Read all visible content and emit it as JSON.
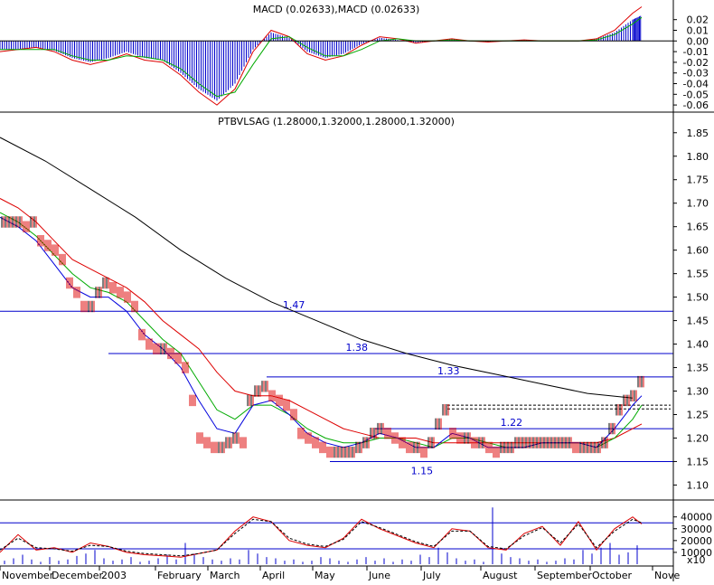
{
  "chart_data": [
    {
      "type": "line",
      "panel": "macd",
      "title": "MACD (0.02633),MACD (0.02633)",
      "ylim": [
        -0.065,
        0.035
      ],
      "yticks": [
        "0.02",
        "0.01",
        "0.00",
        "-0.01",
        "-0.02",
        "-0.03",
        "-0.04",
        "-0.05",
        "-0.06"
      ],
      "zero_line": 0,
      "series": [
        {
          "color": "#dd0000",
          "x": [
            0,
            20,
            40,
            60,
            80,
            100,
            120,
            140,
            160,
            180,
            200,
            220,
            240,
            260,
            280,
            300,
            320,
            340,
            360,
            380,
            400,
            420,
            440,
            460,
            480,
            500,
            520,
            540,
            560,
            580,
            600,
            620,
            640,
            660,
            680,
            700,
            710
          ],
          "values": [
            -0.01,
            -0.008,
            -0.006,
            -0.01,
            -0.018,
            -0.022,
            -0.018,
            -0.012,
            -0.018,
            -0.02,
            -0.032,
            -0.048,
            -0.06,
            -0.045,
            -0.01,
            0.01,
            0.004,
            -0.012,
            -0.018,
            -0.014,
            -0.004,
            0.004,
            0.002,
            -0.002,
            0.0,
            0.002,
            0.0,
            -0.001,
            0.0,
            0.001,
            0.0,
            0.0,
            0.0,
            0.002,
            0.01,
            0.026,
            0.032
          ]
        },
        {
          "color": "#00aa00",
          "x": [
            0,
            20,
            40,
            60,
            80,
            100,
            120,
            140,
            160,
            180,
            200,
            220,
            240,
            260,
            280,
            300,
            320,
            340,
            360,
            380,
            400,
            420,
            440,
            460,
            480,
            500,
            520,
            540,
            560,
            580,
            600,
            620,
            640,
            660,
            680,
            700,
            710
          ],
          "values": [
            -0.008,
            -0.008,
            -0.008,
            -0.008,
            -0.014,
            -0.018,
            -0.018,
            -0.014,
            -0.015,
            -0.018,
            -0.026,
            -0.04,
            -0.052,
            -0.048,
            -0.022,
            0.002,
            0.004,
            -0.006,
            -0.014,
            -0.014,
            -0.008,
            0.0,
            0.002,
            0.0,
            0.0,
            0.001,
            0.0,
            0.0,
            0.0,
            0.0,
            0.0,
            0.0,
            0.0,
            0.001,
            0.006,
            0.016,
            0.022
          ]
        }
      ],
      "histogram": {
        "color": "#0000cc",
        "x": [
          0,
          20,
          40,
          60,
          80,
          100,
          120,
          140,
          160,
          180,
          200,
          220,
          240,
          260,
          280,
          300,
          320,
          340,
          360,
          380,
          400,
          420,
          440,
          460,
          480,
          500,
          520,
          540,
          560,
          580,
          600,
          620,
          640,
          660,
          680,
          700,
          710
        ],
        "values": [
          -0.008,
          -0.008,
          -0.006,
          -0.009,
          -0.016,
          -0.02,
          -0.016,
          -0.01,
          -0.016,
          -0.018,
          -0.03,
          -0.045,
          -0.056,
          -0.04,
          -0.008,
          0.008,
          0.003,
          -0.01,
          -0.016,
          -0.012,
          -0.003,
          0.003,
          0.001,
          -0.002,
          0.0,
          0.002,
          0.0,
          -0.001,
          0.0,
          0.001,
          0.0,
          0.0,
          0.0,
          0.002,
          0.008,
          0.02,
          0.024
        ]
      }
    },
    {
      "type": "line",
      "panel": "price",
      "title": "PTBVLSAG (1.28000,1.32000,1.28000,1.32000)",
      "ylim": [
        1.07,
        1.89
      ],
      "yticks": [
        "1.85",
        "1.80",
        "1.75",
        "1.70",
        "1.65",
        "1.60",
        "1.55",
        "1.50",
        "1.45",
        "1.40",
        "1.35",
        "1.30",
        "1.25",
        "1.20",
        "1.15",
        "1.10"
      ],
      "series": [
        {
          "color": "#000000",
          "x": [
            0,
            50,
            100,
            150,
            200,
            250,
            300,
            350,
            400,
            450,
            500,
            550,
            600,
            650,
            700
          ],
          "values": [
            1.84,
            1.79,
            1.73,
            1.67,
            1.6,
            1.54,
            1.49,
            1.45,
            1.41,
            1.38,
            1.355,
            1.335,
            1.315,
            1.295,
            1.285
          ]
        },
        {
          "color": "#dd0000",
          "x": [
            0,
            20,
            40,
            60,
            80,
            100,
            120,
            140,
            160,
            180,
            200,
            220,
            240,
            260,
            280,
            300,
            320,
            340,
            360,
            380,
            400,
            420,
            440,
            460,
            480,
            500,
            520,
            540,
            560,
            580,
            600,
            620,
            640,
            660,
            680,
            700,
            710
          ],
          "values": [
            1.71,
            1.69,
            1.66,
            1.62,
            1.58,
            1.56,
            1.54,
            1.52,
            1.49,
            1.45,
            1.42,
            1.39,
            1.34,
            1.3,
            1.29,
            1.29,
            1.28,
            1.26,
            1.24,
            1.22,
            1.21,
            1.2,
            1.2,
            1.2,
            1.19,
            1.19,
            1.19,
            1.19,
            1.19,
            1.19,
            1.19,
            1.19,
            1.19,
            1.19,
            1.2,
            1.22,
            1.23
          ]
        },
        {
          "color": "#00aa00",
          "x": [
            0,
            20,
            40,
            60,
            80,
            100,
            120,
            140,
            160,
            180,
            200,
            220,
            240,
            260,
            280,
            300,
            320,
            340,
            360,
            380,
            400,
            420,
            440,
            460,
            480,
            500,
            520,
            540,
            560,
            580,
            600,
            620,
            640,
            660,
            680,
            700,
            710
          ],
          "values": [
            1.68,
            1.66,
            1.63,
            1.59,
            1.55,
            1.52,
            1.51,
            1.49,
            1.45,
            1.41,
            1.38,
            1.32,
            1.26,
            1.24,
            1.27,
            1.27,
            1.25,
            1.22,
            1.2,
            1.19,
            1.19,
            1.2,
            1.2,
            1.19,
            1.18,
            1.2,
            1.2,
            1.19,
            1.18,
            1.18,
            1.19,
            1.19,
            1.19,
            1.18,
            1.2,
            1.24,
            1.27
          ]
        },
        {
          "color": "#0000dd",
          "x": [
            0,
            20,
            40,
            60,
            80,
            100,
            120,
            140,
            160,
            180,
            200,
            220,
            240,
            260,
            280,
            300,
            320,
            340,
            360,
            380,
            400,
            420,
            440,
            460,
            480,
            500,
            520,
            540,
            560,
            580,
            600,
            620,
            640,
            660,
            680,
            700,
            710
          ],
          "values": [
            1.67,
            1.65,
            1.62,
            1.57,
            1.52,
            1.5,
            1.5,
            1.47,
            1.42,
            1.39,
            1.35,
            1.28,
            1.22,
            1.21,
            1.27,
            1.28,
            1.25,
            1.21,
            1.19,
            1.18,
            1.19,
            1.21,
            1.2,
            1.18,
            1.18,
            1.21,
            1.2,
            1.18,
            1.18,
            1.18,
            1.19,
            1.19,
            1.19,
            1.18,
            1.22,
            1.27,
            1.29
          ]
        }
      ],
      "price_bars": {
        "x": [
          2,
          10,
          18,
          26,
          34,
          42,
          50,
          58,
          66,
          74,
          82,
          90,
          98,
          106,
          114,
          122,
          130,
          138,
          146,
          154,
          162,
          170,
          178,
          186,
          194,
          202,
          210,
          218,
          226,
          234,
          242,
          250,
          258,
          266,
          274,
          282,
          290,
          298,
          306,
          314,
          322,
          330,
          338,
          346,
          354,
          362,
          370,
          378,
          386,
          394,
          402,
          410,
          418,
          426,
          434,
          442,
          450,
          458,
          466,
          474,
          482,
          490,
          498,
          506,
          514,
          522,
          530,
          538,
          546,
          554,
          562,
          570,
          578,
          586,
          594,
          602,
          610,
          618,
          626,
          634,
          642,
          650,
          658,
          666,
          674,
          682,
          690,
          698,
          706
        ],
        "values": [
          1.66,
          1.66,
          1.66,
          1.65,
          1.66,
          1.62,
          1.61,
          1.6,
          1.58,
          1.53,
          1.51,
          1.48,
          1.48,
          1.51,
          1.53,
          1.52,
          1.51,
          1.5,
          1.48,
          1.42,
          1.4,
          1.39,
          1.39,
          1.38,
          1.37,
          1.35,
          1.28,
          1.2,
          1.19,
          1.18,
          1.18,
          1.19,
          1.2,
          1.19,
          1.28,
          1.3,
          1.31,
          1.29,
          1.28,
          1.27,
          1.25,
          1.21,
          1.2,
          1.19,
          1.18,
          1.17,
          1.17,
          1.17,
          1.17,
          1.18,
          1.19,
          1.21,
          1.22,
          1.21,
          1.2,
          1.19,
          1.18,
          1.18,
          1.17,
          1.19,
          1.23,
          1.26,
          1.21,
          1.2,
          1.2,
          1.19,
          1.19,
          1.18,
          1.17,
          1.18,
          1.18,
          1.19,
          1.19,
          1.19,
          1.19,
          1.19,
          1.19,
          1.19,
          1.19,
          1.18,
          1.18,
          1.18,
          1.18,
          1.19,
          1.22,
          1.26,
          1.28,
          1.29,
          1.32
        ]
      },
      "horizontal_levels": [
        {
          "value": 1.47,
          "label": "1.47",
          "from_x": 0
        },
        {
          "value": 1.38,
          "label": "1.38",
          "from_x": 120
        },
        {
          "value": 1.33,
          "label": "1.33",
          "from_x": 295
        },
        {
          "value": 1.22,
          "label": "1.22",
          "from_x": 415
        },
        {
          "value": 1.15,
          "label": "1.15",
          "from_x": 365
        }
      ],
      "dashed_levels": [
        {
          "value": 1.27,
          "from_x": 495
        },
        {
          "value": 1.262,
          "from_x": 495
        }
      ]
    },
    {
      "type": "bar",
      "panel": "volume",
      "ylim": [
        0,
        52000
      ],
      "yticks": [
        "40000",
        "30000",
        "20000",
        "10000"
      ],
      "yaxis_multiplier_label": "x10",
      "reference_lines": [
        35000,
        13000
      ],
      "volume_x": [
        5,
        15,
        25,
        35,
        45,
        55,
        65,
        75,
        85,
        95,
        105,
        115,
        125,
        135,
        145,
        155,
        165,
        175,
        185,
        195,
        205,
        215,
        225,
        235,
        245,
        255,
        265,
        275,
        285,
        295,
        305,
        315,
        325,
        335,
        345,
        355,
        365,
        375,
        385,
        395,
        405,
        415,
        425,
        435,
        445,
        455,
        465,
        475,
        485,
        495,
        505,
        515,
        525,
        535,
        545,
        555,
        565,
        575,
        585,
        595,
        605,
        615,
        625,
        635,
        645,
        655,
        665,
        675,
        685,
        695,
        705
      ],
      "volume_values": [
        3000,
        5000,
        8000,
        4000,
        2000,
        6000,
        3000,
        4000,
        7000,
        9000,
        12000,
        5000,
        3000,
        4000,
        6000,
        2000,
        3000,
        5000,
        8000,
        4000,
        18000,
        9000,
        6000,
        4000,
        3000,
        5000,
        4000,
        12000,
        9000,
        6000,
        5000,
        3000,
        4000,
        2000,
        3000,
        6000,
        5000,
        3000,
        2000,
        4000,
        6000,
        3000,
        5000,
        2000,
        4000,
        3000,
        8000,
        6000,
        14000,
        10000,
        5000,
        3000,
        4000,
        2000,
        48000,
        9000,
        6000,
        5000,
        3000,
        4000,
        2000,
        3000,
        5000,
        4000,
        12000,
        9000,
        14000,
        18000,
        8000,
        10000,
        16000
      ],
      "osc_x": [
        0,
        20,
        40,
        60,
        80,
        100,
        120,
        140,
        160,
        180,
        200,
        220,
        240,
        260,
        280,
        300,
        320,
        340,
        360,
        380,
        400,
        420,
        440,
        460,
        480,
        500,
        520,
        540,
        560,
        580,
        600,
        620,
        640,
        660,
        680,
        700,
        710
      ],
      "osc_values": [
        10000,
        25000,
        12000,
        14000,
        10000,
        18000,
        15000,
        10000,
        8000,
        7000,
        6000,
        9000,
        12000,
        28000,
        40000,
        36000,
        20000,
        16000,
        14000,
        22000,
        38000,
        30000,
        24000,
        18000,
        14000,
        30000,
        28000,
        14000,
        12000,
        26000,
        32000,
        16000,
        36000,
        12000,
        30000,
        40000,
        34000
      ],
      "signal_values": [
        12000,
        22000,
        14000,
        13000,
        11000,
        16000,
        15000,
        11000,
        9000,
        8000,
        7000,
        9000,
        12000,
        26000,
        38000,
        36000,
        22000,
        17000,
        15000,
        21000,
        36000,
        31000,
        25000,
        19000,
        15000,
        28000,
        28000,
        15000,
        13000,
        24000,
        31000,
        18000,
        34000,
        14000,
        28000,
        38000,
        35000
      ]
    }
  ],
  "x_axis": {
    "labels": [
      "November",
      "December",
      "2003",
      "February",
      "March",
      "April",
      "May",
      "June",
      "July",
      "August",
      "September",
      "October",
      "Nove"
    ],
    "label_x": [
      0,
      55,
      110,
      172,
      230,
      288,
      346,
      406,
      466,
      532,
      592,
      653,
      722
    ]
  },
  "colors": {
    "up_bar": "#000000",
    "down_bar": "#dd0000",
    "axis": "#000000",
    "level_line": "#0000cc",
    "volume_bar": "#0000cc"
  }
}
